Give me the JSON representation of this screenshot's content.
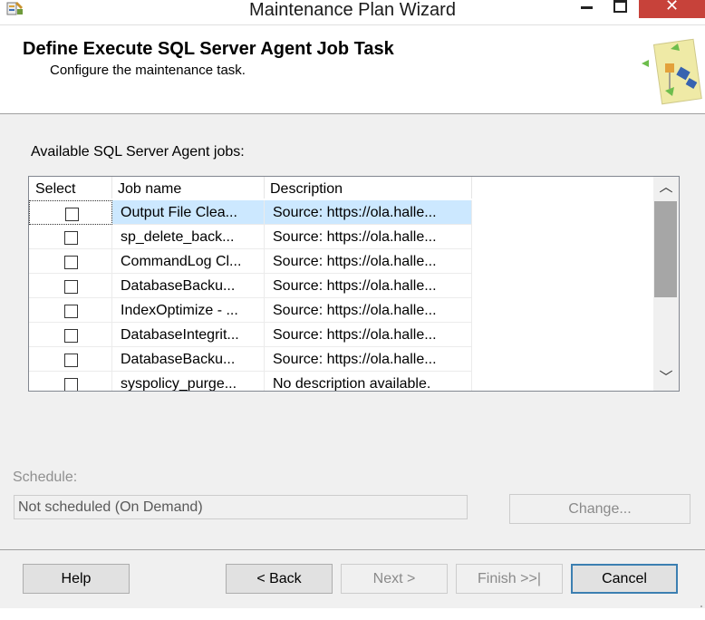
{
  "window": {
    "title": "Maintenance Plan Wizard",
    "close_glyph": "✕",
    "icons": {
      "app": "wizard-app-icon",
      "minimize": "minimize-icon",
      "maximize": "maximize-icon",
      "close": "close-icon"
    }
  },
  "header": {
    "title": "Define Execute SQL Server Agent Job Task",
    "subtitle": "Configure the maintenance task.",
    "icon": "wizard-task-icon"
  },
  "jobs_label": "Available SQL Server Agent jobs:",
  "jobs_table": {
    "columns": [
      "Select",
      "Job name",
      "Description"
    ],
    "rows": [
      {
        "selected": false,
        "name": "Output File Clea...",
        "description": "Source: https://ola.halle...",
        "highlighted": true
      },
      {
        "selected": false,
        "name": "sp_delete_back...",
        "description": "Source: https://ola.halle..."
      },
      {
        "selected": false,
        "name": "CommandLog Cl...",
        "description": "Source: https://ola.halle..."
      },
      {
        "selected": false,
        "name": "DatabaseBacku...",
        "description": "Source: https://ola.halle..."
      },
      {
        "selected": false,
        "name": "IndexOptimize - ...",
        "description": "Source: https://ola.halle..."
      },
      {
        "selected": false,
        "name": "DatabaseIntegrit...",
        "description": "Source: https://ola.halle..."
      },
      {
        "selected": false,
        "name": "DatabaseBacku...",
        "description": "Source: https://ola.halle..."
      },
      {
        "selected": false,
        "name": "syspolicy_purge...",
        "description": "No description available."
      }
    ],
    "scroll_up_glyph": "︿",
    "scroll_down_glyph": "﹀"
  },
  "schedule": {
    "label": "Schedule:",
    "value": "Not scheduled (On Demand)",
    "change_button": "Change..."
  },
  "footer": {
    "help": "Help",
    "back": "< Back",
    "next": "Next >",
    "finish": "Finish >>|",
    "cancel": "Cancel"
  },
  "colors": {
    "selection": "#cce8ff",
    "close_button": "#c7423a"
  }
}
